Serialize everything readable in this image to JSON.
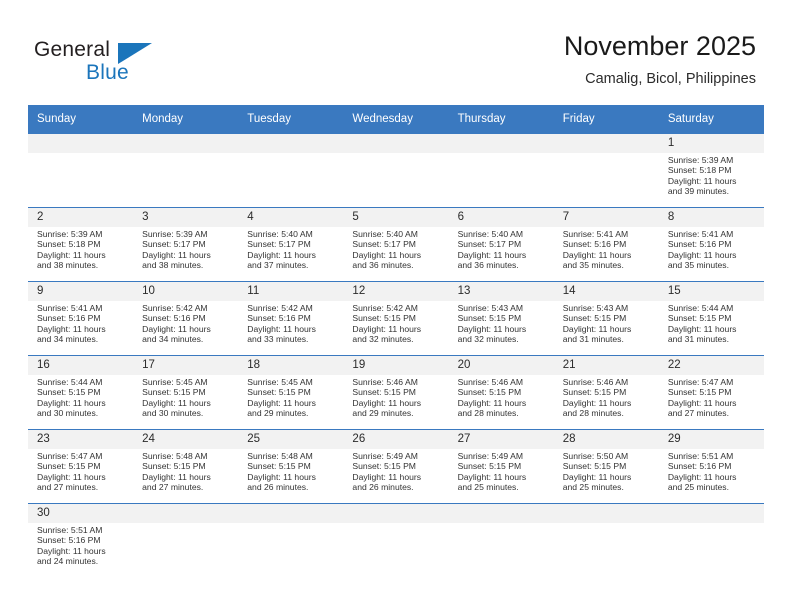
{
  "logo": {
    "word_top": "General",
    "word_bottom": "Blue",
    "triangle_color": "#1b75bb"
  },
  "header": {
    "title": "November 2025",
    "subtitle": "Camalig, Bicol, Philippines"
  },
  "colors": {
    "header_blue": "#3a79c0",
    "daynum_background": "#f2f2f2",
    "logo_blue": "#1b75bb"
  },
  "calendar": {
    "weekday_headers": [
      "Sunday",
      "Monday",
      "Tuesday",
      "Wednesday",
      "Thursday",
      "Friday",
      "Saturday"
    ],
    "weeks": [
      [
        {
          "day": "",
          "sunrise": "",
          "sunset": "",
          "daylight_line1": "",
          "daylight_line2": "",
          "blank": true
        },
        {
          "day": "",
          "sunrise": "",
          "sunset": "",
          "daylight_line1": "",
          "daylight_line2": "",
          "blank": true
        },
        {
          "day": "",
          "sunrise": "",
          "sunset": "",
          "daylight_line1": "",
          "daylight_line2": "",
          "blank": true
        },
        {
          "day": "",
          "sunrise": "",
          "sunset": "",
          "daylight_line1": "",
          "daylight_line2": "",
          "blank": true
        },
        {
          "day": "",
          "sunrise": "",
          "sunset": "",
          "daylight_line1": "",
          "daylight_line2": "",
          "blank": true
        },
        {
          "day": "",
          "sunrise": "",
          "sunset": "",
          "daylight_line1": "",
          "daylight_line2": "",
          "blank": true
        },
        {
          "day": "1",
          "sunrise": "Sunrise: 5:39 AM",
          "sunset": "Sunset: 5:18 PM",
          "daylight_line1": "Daylight: 11 hours",
          "daylight_line2": "and 39 minutes."
        }
      ],
      [
        {
          "day": "2",
          "sunrise": "Sunrise: 5:39 AM",
          "sunset": "Sunset: 5:18 PM",
          "daylight_line1": "Daylight: 11 hours",
          "daylight_line2": "and 38 minutes."
        },
        {
          "day": "3",
          "sunrise": "Sunrise: 5:39 AM",
          "sunset": "Sunset: 5:17 PM",
          "daylight_line1": "Daylight: 11 hours",
          "daylight_line2": "and 38 minutes."
        },
        {
          "day": "4",
          "sunrise": "Sunrise: 5:40 AM",
          "sunset": "Sunset: 5:17 PM",
          "daylight_line1": "Daylight: 11 hours",
          "daylight_line2": "and 37 minutes."
        },
        {
          "day": "5",
          "sunrise": "Sunrise: 5:40 AM",
          "sunset": "Sunset: 5:17 PM",
          "daylight_line1": "Daylight: 11 hours",
          "daylight_line2": "and 36 minutes."
        },
        {
          "day": "6",
          "sunrise": "Sunrise: 5:40 AM",
          "sunset": "Sunset: 5:17 PM",
          "daylight_line1": "Daylight: 11 hours",
          "daylight_line2": "and 36 minutes."
        },
        {
          "day": "7",
          "sunrise": "Sunrise: 5:41 AM",
          "sunset": "Sunset: 5:16 PM",
          "daylight_line1": "Daylight: 11 hours",
          "daylight_line2": "and 35 minutes."
        },
        {
          "day": "8",
          "sunrise": "Sunrise: 5:41 AM",
          "sunset": "Sunset: 5:16 PM",
          "daylight_line1": "Daylight: 11 hours",
          "daylight_line2": "and 35 minutes."
        }
      ],
      [
        {
          "day": "9",
          "sunrise": "Sunrise: 5:41 AM",
          "sunset": "Sunset: 5:16 PM",
          "daylight_line1": "Daylight: 11 hours",
          "daylight_line2": "and 34 minutes."
        },
        {
          "day": "10",
          "sunrise": "Sunrise: 5:42 AM",
          "sunset": "Sunset: 5:16 PM",
          "daylight_line1": "Daylight: 11 hours",
          "daylight_line2": "and 34 minutes."
        },
        {
          "day": "11",
          "sunrise": "Sunrise: 5:42 AM",
          "sunset": "Sunset: 5:16 PM",
          "daylight_line1": "Daylight: 11 hours",
          "daylight_line2": "and 33 minutes."
        },
        {
          "day": "12",
          "sunrise": "Sunrise: 5:42 AM",
          "sunset": "Sunset: 5:15 PM",
          "daylight_line1": "Daylight: 11 hours",
          "daylight_line2": "and 32 minutes."
        },
        {
          "day": "13",
          "sunrise": "Sunrise: 5:43 AM",
          "sunset": "Sunset: 5:15 PM",
          "daylight_line1": "Daylight: 11 hours",
          "daylight_line2": "and 32 minutes."
        },
        {
          "day": "14",
          "sunrise": "Sunrise: 5:43 AM",
          "sunset": "Sunset: 5:15 PM",
          "daylight_line1": "Daylight: 11 hours",
          "daylight_line2": "and 31 minutes."
        },
        {
          "day": "15",
          "sunrise": "Sunrise: 5:44 AM",
          "sunset": "Sunset: 5:15 PM",
          "daylight_line1": "Daylight: 11 hours",
          "daylight_line2": "and 31 minutes."
        }
      ],
      [
        {
          "day": "16",
          "sunrise": "Sunrise: 5:44 AM",
          "sunset": "Sunset: 5:15 PM",
          "daylight_line1": "Daylight: 11 hours",
          "daylight_line2": "and 30 minutes."
        },
        {
          "day": "17",
          "sunrise": "Sunrise: 5:45 AM",
          "sunset": "Sunset: 5:15 PM",
          "daylight_line1": "Daylight: 11 hours",
          "daylight_line2": "and 30 minutes."
        },
        {
          "day": "18",
          "sunrise": "Sunrise: 5:45 AM",
          "sunset": "Sunset: 5:15 PM",
          "daylight_line1": "Daylight: 11 hours",
          "daylight_line2": "and 29 minutes."
        },
        {
          "day": "19",
          "sunrise": "Sunrise: 5:46 AM",
          "sunset": "Sunset: 5:15 PM",
          "daylight_line1": "Daylight: 11 hours",
          "daylight_line2": "and 29 minutes."
        },
        {
          "day": "20",
          "sunrise": "Sunrise: 5:46 AM",
          "sunset": "Sunset: 5:15 PM",
          "daylight_line1": "Daylight: 11 hours",
          "daylight_line2": "and 28 minutes."
        },
        {
          "day": "21",
          "sunrise": "Sunrise: 5:46 AM",
          "sunset": "Sunset: 5:15 PM",
          "daylight_line1": "Daylight: 11 hours",
          "daylight_line2": "and 28 minutes."
        },
        {
          "day": "22",
          "sunrise": "Sunrise: 5:47 AM",
          "sunset": "Sunset: 5:15 PM",
          "daylight_line1": "Daylight: 11 hours",
          "daylight_line2": "and 27 minutes."
        }
      ],
      [
        {
          "day": "23",
          "sunrise": "Sunrise: 5:47 AM",
          "sunset": "Sunset: 5:15 PM",
          "daylight_line1": "Daylight: 11 hours",
          "daylight_line2": "and 27 minutes."
        },
        {
          "day": "24",
          "sunrise": "Sunrise: 5:48 AM",
          "sunset": "Sunset: 5:15 PM",
          "daylight_line1": "Daylight: 11 hours",
          "daylight_line2": "and 27 minutes."
        },
        {
          "day": "25",
          "sunrise": "Sunrise: 5:48 AM",
          "sunset": "Sunset: 5:15 PM",
          "daylight_line1": "Daylight: 11 hours",
          "daylight_line2": "and 26 minutes."
        },
        {
          "day": "26",
          "sunrise": "Sunrise: 5:49 AM",
          "sunset": "Sunset: 5:15 PM",
          "daylight_line1": "Daylight: 11 hours",
          "daylight_line2": "and 26 minutes."
        },
        {
          "day": "27",
          "sunrise": "Sunrise: 5:49 AM",
          "sunset": "Sunset: 5:15 PM",
          "daylight_line1": "Daylight: 11 hours",
          "daylight_line2": "and 25 minutes."
        },
        {
          "day": "28",
          "sunrise": "Sunrise: 5:50 AM",
          "sunset": "Sunset: 5:15 PM",
          "daylight_line1": "Daylight: 11 hours",
          "daylight_line2": "and 25 minutes."
        },
        {
          "day": "29",
          "sunrise": "Sunrise: 5:51 AM",
          "sunset": "Sunset: 5:16 PM",
          "daylight_line1": "Daylight: 11 hours",
          "daylight_line2": "and 25 minutes."
        }
      ],
      [
        {
          "day": "30",
          "sunrise": "Sunrise: 5:51 AM",
          "sunset": "Sunset: 5:16 PM",
          "daylight_line1": "Daylight: 11 hours",
          "daylight_line2": "and 24 minutes."
        },
        {
          "day": "",
          "sunrise": "",
          "sunset": "",
          "daylight_line1": "",
          "daylight_line2": "",
          "blank": true
        },
        {
          "day": "",
          "sunrise": "",
          "sunset": "",
          "daylight_line1": "",
          "daylight_line2": "",
          "blank": true
        },
        {
          "day": "",
          "sunrise": "",
          "sunset": "",
          "daylight_line1": "",
          "daylight_line2": "",
          "blank": true
        },
        {
          "day": "",
          "sunrise": "",
          "sunset": "",
          "daylight_line1": "",
          "daylight_line2": "",
          "blank": true
        },
        {
          "day": "",
          "sunrise": "",
          "sunset": "",
          "daylight_line1": "",
          "daylight_line2": "",
          "blank": true
        },
        {
          "day": "",
          "sunrise": "",
          "sunset": "",
          "daylight_line1": "",
          "daylight_line2": "",
          "blank": true
        }
      ]
    ]
  }
}
